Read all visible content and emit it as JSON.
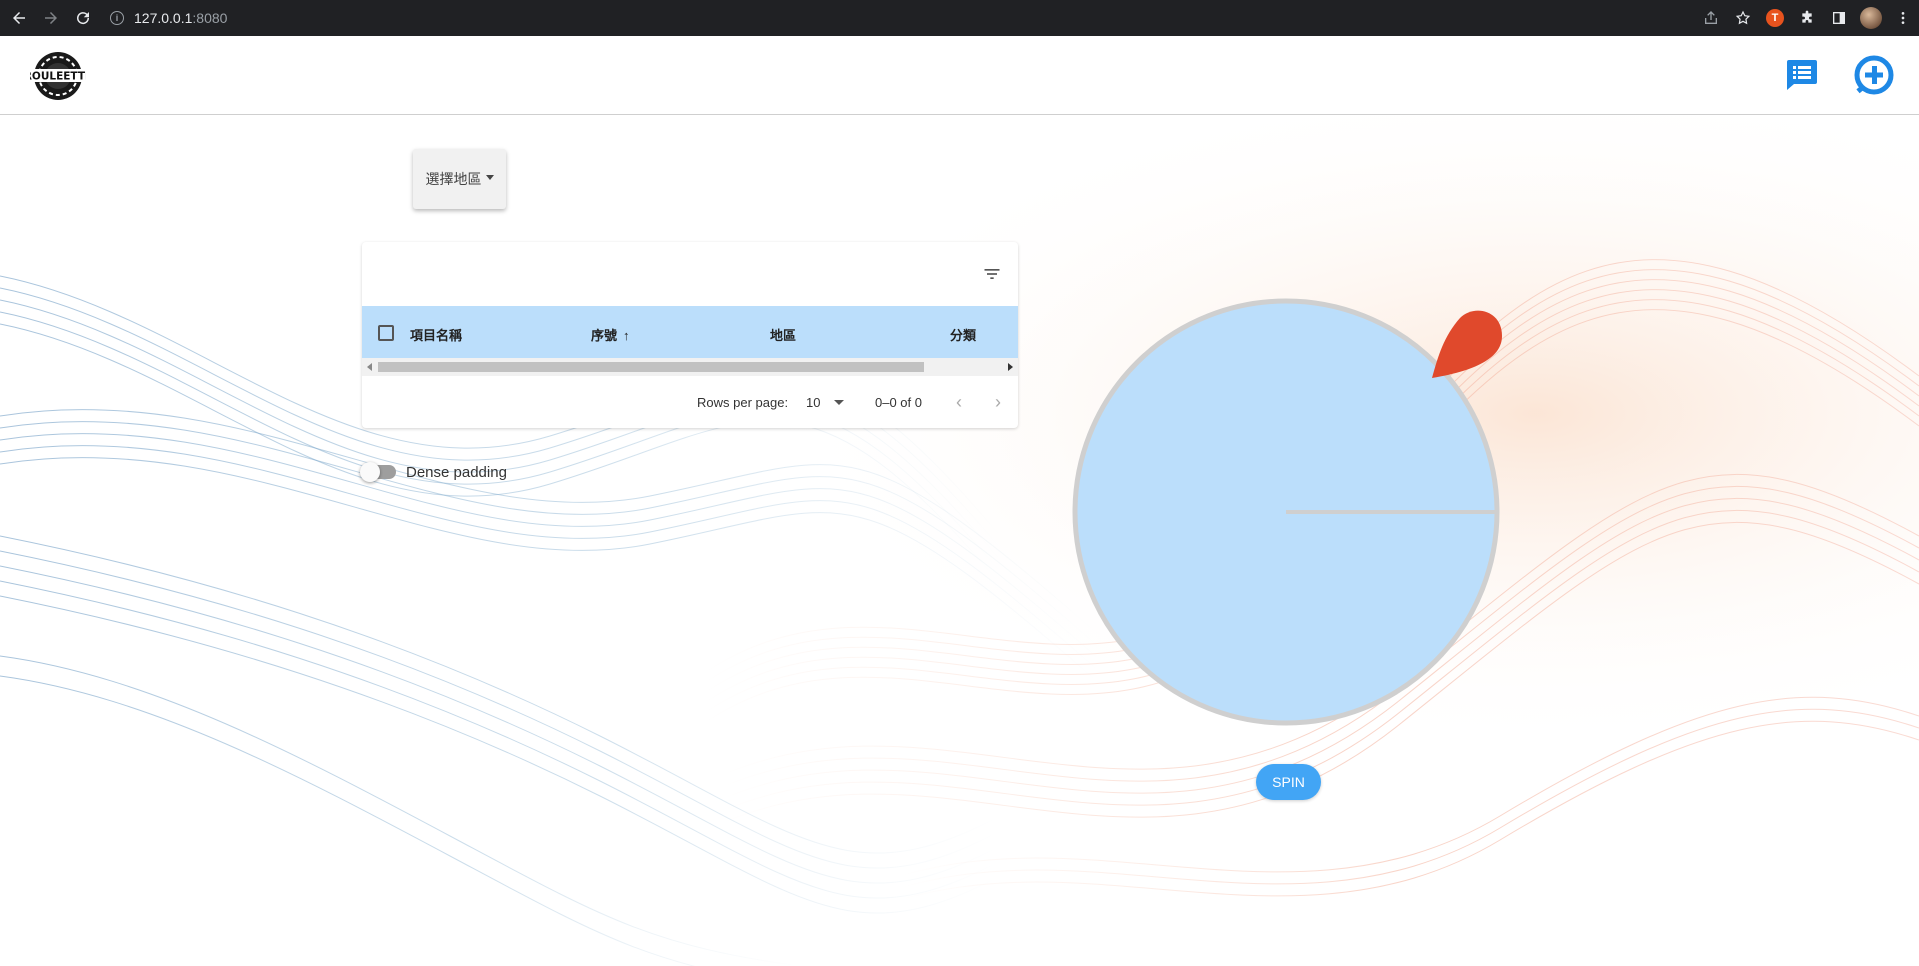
{
  "browser": {
    "url_host": "127.0.0.1",
    "url_port": ":8080",
    "ext_badge": "T"
  },
  "app": {
    "logo_text": "ROULEETTE"
  },
  "region_select": {
    "label": "選擇地區"
  },
  "table": {
    "columns": [
      "項目名稱",
      "序號",
      "地區",
      "分類"
    ],
    "sort_arrow": "↑",
    "rows_per_page_label": "Rows per page:",
    "rows_per_page_value": "10",
    "range_text": "0–0 of 0",
    "prev_icon": "‹",
    "next_icon": "›"
  },
  "dense_padding": {
    "label": "Dense padding",
    "checked": false
  },
  "wheel": {
    "spin_label": "SPIN",
    "fill_color": "#bbdefb",
    "pointer_color": "#e0492c"
  },
  "colors": {
    "accent": "#1e88e5",
    "header_row": "#bbdefb",
    "spin_button": "#42a5f5"
  }
}
